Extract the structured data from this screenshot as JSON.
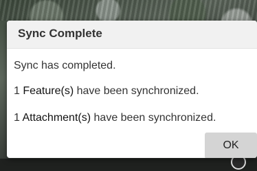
{
  "dialog": {
    "title": "Sync Complete",
    "message": "Sync has completed.",
    "feature_count": "1",
    "feature_label": "Feature(s)",
    "feature_suffix": "have been synchronized.",
    "attachment_count": "1",
    "attachment_label": "Attachment(s)",
    "attachment_suffix": "have been synchronized.",
    "ok_label": "OK"
  }
}
